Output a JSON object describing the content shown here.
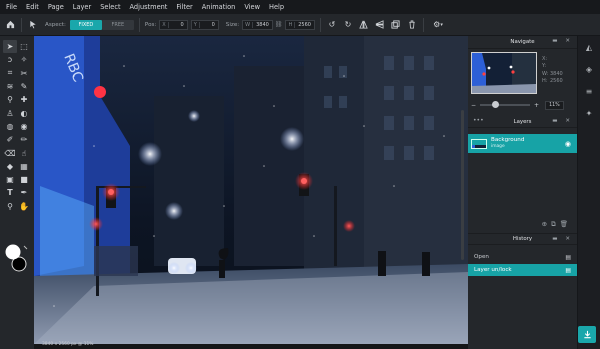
{
  "menu": [
    "File",
    "Edit",
    "Page",
    "Layer",
    "Select",
    "Adjustment",
    "Filter",
    "Animation",
    "View",
    "Help"
  ],
  "toolbar": {
    "home_icon": "home-icon",
    "pointer_icon": "pointer-icon",
    "aspect_label": "Aspect:",
    "aspect_options": [
      "FIXED",
      "FREE"
    ],
    "aspect_selected": "FIXED",
    "pos_label": "Pos:",
    "x_label": "X",
    "x_value": "0",
    "y_label": "Y",
    "y_value": "0",
    "size_label": "Size:",
    "w_label": "W",
    "w_value": "3840",
    "h_label": "H",
    "h_value": "2560"
  },
  "canvas": {
    "status": "3840 x 2560 px @ 11%",
    "sky_color": "#0c1626",
    "accent": "#1aa7ab"
  },
  "navigate": {
    "title": "Navigate",
    "labels": [
      "X:",
      "Y:",
      "W:",
      "H:"
    ],
    "values": [
      "",
      "",
      "3840",
      "2560"
    ],
    "zoom_minus": "−",
    "zoom_plus": "+",
    "zoom_value": "11%",
    "zoom_level": 0.3
  },
  "layers": {
    "title": "Layers",
    "items": [
      {
        "name": "Background",
        "type": "image"
      }
    ]
  },
  "history": {
    "title": "History",
    "items": [
      {
        "label": "Open",
        "selected": false
      },
      {
        "label": "Layer un/lock",
        "selected": true
      }
    ]
  },
  "close_glyph": "✕",
  "expand_glyph": "▬"
}
